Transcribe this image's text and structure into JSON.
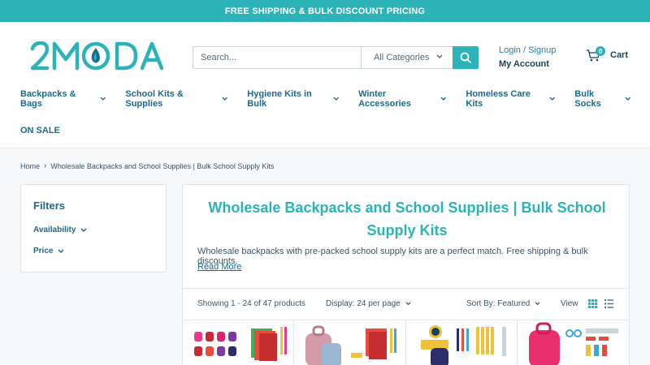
{
  "announcement": "FREE SHIPPING & BULK DISCOUNT PRICING",
  "brand": {
    "name": "2MODA",
    "color": "#2bb3b8"
  },
  "search": {
    "placeholder": "Search...",
    "category": "All Categories"
  },
  "account": {
    "login": "Login / Signup",
    "label": "My Account"
  },
  "cart": {
    "count": "0",
    "label": "Cart"
  },
  "nav": {
    "items": [
      {
        "label": "Backpacks & Bags"
      },
      {
        "label": "School Kits & Supplies"
      },
      {
        "label": "Hygiene Kits in Bulk"
      },
      {
        "label": "Winter Accessories"
      },
      {
        "label": "Homeless Care Kits"
      },
      {
        "label": "Bulk Socks"
      }
    ],
    "sale": "ON SALE"
  },
  "breadcrumb": {
    "home": "Home",
    "separator": "›",
    "current": "Wholesale Backpacks and School Supplies | Bulk School Supply Kits"
  },
  "filters": {
    "title": "Filters",
    "availability": "Availability",
    "price": "Price"
  },
  "collection": {
    "title": "Wholesale Backpacks and School Supplies | Bulk School Supply Kits",
    "description": "Wholesale backpacks with pre-packed school supply kits are a perfect match. Free shipping & bulk discounts.",
    "read_more": "Read More"
  },
  "toolbar": {
    "showing": "Showing 1 - 24 of 47 products",
    "display": "Display: 24 per page",
    "sort": "Sort By: Featured",
    "view": "View"
  },
  "icons": {
    "search": "search-icon",
    "cart": "cart-icon",
    "chevron": "chevron-down-icon",
    "grid": "grid-view-icon",
    "list": "list-view-icon"
  },
  "colors": {
    "accent": "#2bb3b8",
    "nav": "#1c6a8e",
    "text": "#3c5566"
  }
}
